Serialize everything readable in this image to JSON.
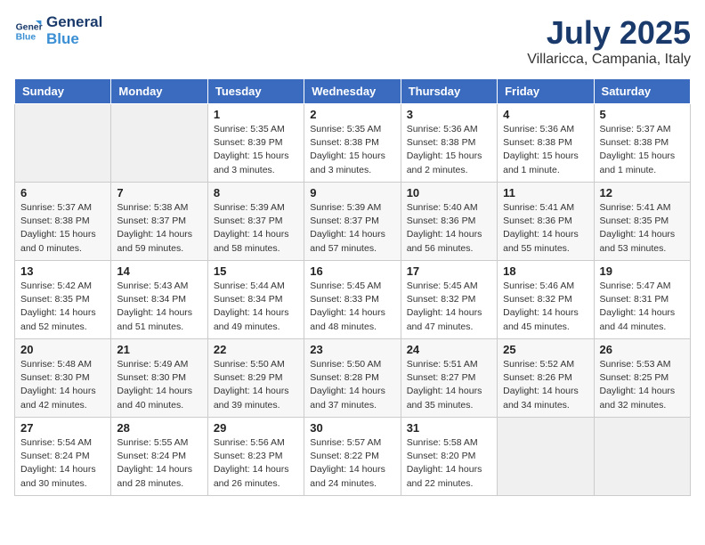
{
  "header": {
    "logo_line1": "General",
    "logo_line2": "Blue",
    "month_title": "July 2025",
    "location": "Villaricca, Campania, Italy"
  },
  "weekdays": [
    "Sunday",
    "Monday",
    "Tuesday",
    "Wednesday",
    "Thursday",
    "Friday",
    "Saturday"
  ],
  "weeks": [
    [
      {
        "day": "",
        "info": ""
      },
      {
        "day": "",
        "info": ""
      },
      {
        "day": "1",
        "info": "Sunrise: 5:35 AM\nSunset: 8:39 PM\nDaylight: 15 hours\nand 3 minutes."
      },
      {
        "day": "2",
        "info": "Sunrise: 5:35 AM\nSunset: 8:38 PM\nDaylight: 15 hours\nand 3 minutes."
      },
      {
        "day": "3",
        "info": "Sunrise: 5:36 AM\nSunset: 8:38 PM\nDaylight: 15 hours\nand 2 minutes."
      },
      {
        "day": "4",
        "info": "Sunrise: 5:36 AM\nSunset: 8:38 PM\nDaylight: 15 hours\nand 1 minute."
      },
      {
        "day": "5",
        "info": "Sunrise: 5:37 AM\nSunset: 8:38 PM\nDaylight: 15 hours\nand 1 minute."
      }
    ],
    [
      {
        "day": "6",
        "info": "Sunrise: 5:37 AM\nSunset: 8:38 PM\nDaylight: 15 hours\nand 0 minutes."
      },
      {
        "day": "7",
        "info": "Sunrise: 5:38 AM\nSunset: 8:37 PM\nDaylight: 14 hours\nand 59 minutes."
      },
      {
        "day": "8",
        "info": "Sunrise: 5:39 AM\nSunset: 8:37 PM\nDaylight: 14 hours\nand 58 minutes."
      },
      {
        "day": "9",
        "info": "Sunrise: 5:39 AM\nSunset: 8:37 PM\nDaylight: 14 hours\nand 57 minutes."
      },
      {
        "day": "10",
        "info": "Sunrise: 5:40 AM\nSunset: 8:36 PM\nDaylight: 14 hours\nand 56 minutes."
      },
      {
        "day": "11",
        "info": "Sunrise: 5:41 AM\nSunset: 8:36 PM\nDaylight: 14 hours\nand 55 minutes."
      },
      {
        "day": "12",
        "info": "Sunrise: 5:41 AM\nSunset: 8:35 PM\nDaylight: 14 hours\nand 53 minutes."
      }
    ],
    [
      {
        "day": "13",
        "info": "Sunrise: 5:42 AM\nSunset: 8:35 PM\nDaylight: 14 hours\nand 52 minutes."
      },
      {
        "day": "14",
        "info": "Sunrise: 5:43 AM\nSunset: 8:34 PM\nDaylight: 14 hours\nand 51 minutes."
      },
      {
        "day": "15",
        "info": "Sunrise: 5:44 AM\nSunset: 8:34 PM\nDaylight: 14 hours\nand 49 minutes."
      },
      {
        "day": "16",
        "info": "Sunrise: 5:45 AM\nSunset: 8:33 PM\nDaylight: 14 hours\nand 48 minutes."
      },
      {
        "day": "17",
        "info": "Sunrise: 5:45 AM\nSunset: 8:32 PM\nDaylight: 14 hours\nand 47 minutes."
      },
      {
        "day": "18",
        "info": "Sunrise: 5:46 AM\nSunset: 8:32 PM\nDaylight: 14 hours\nand 45 minutes."
      },
      {
        "day": "19",
        "info": "Sunrise: 5:47 AM\nSunset: 8:31 PM\nDaylight: 14 hours\nand 44 minutes."
      }
    ],
    [
      {
        "day": "20",
        "info": "Sunrise: 5:48 AM\nSunset: 8:30 PM\nDaylight: 14 hours\nand 42 minutes."
      },
      {
        "day": "21",
        "info": "Sunrise: 5:49 AM\nSunset: 8:30 PM\nDaylight: 14 hours\nand 40 minutes."
      },
      {
        "day": "22",
        "info": "Sunrise: 5:50 AM\nSunset: 8:29 PM\nDaylight: 14 hours\nand 39 minutes."
      },
      {
        "day": "23",
        "info": "Sunrise: 5:50 AM\nSunset: 8:28 PM\nDaylight: 14 hours\nand 37 minutes."
      },
      {
        "day": "24",
        "info": "Sunrise: 5:51 AM\nSunset: 8:27 PM\nDaylight: 14 hours\nand 35 minutes."
      },
      {
        "day": "25",
        "info": "Sunrise: 5:52 AM\nSunset: 8:26 PM\nDaylight: 14 hours\nand 34 minutes."
      },
      {
        "day": "26",
        "info": "Sunrise: 5:53 AM\nSunset: 8:25 PM\nDaylight: 14 hours\nand 32 minutes."
      }
    ],
    [
      {
        "day": "27",
        "info": "Sunrise: 5:54 AM\nSunset: 8:24 PM\nDaylight: 14 hours\nand 30 minutes."
      },
      {
        "day": "28",
        "info": "Sunrise: 5:55 AM\nSunset: 8:24 PM\nDaylight: 14 hours\nand 28 minutes."
      },
      {
        "day": "29",
        "info": "Sunrise: 5:56 AM\nSunset: 8:23 PM\nDaylight: 14 hours\nand 26 minutes."
      },
      {
        "day": "30",
        "info": "Sunrise: 5:57 AM\nSunset: 8:22 PM\nDaylight: 14 hours\nand 24 minutes."
      },
      {
        "day": "31",
        "info": "Sunrise: 5:58 AM\nSunset: 8:20 PM\nDaylight: 14 hours\nand 22 minutes."
      },
      {
        "day": "",
        "info": ""
      },
      {
        "day": "",
        "info": ""
      }
    ]
  ]
}
